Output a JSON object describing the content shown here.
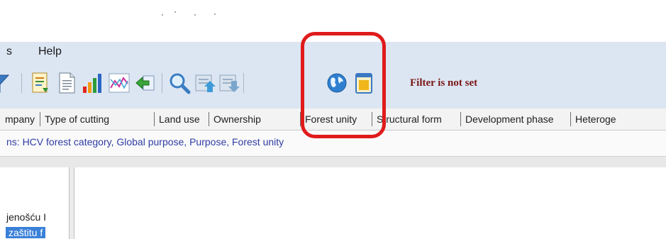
{
  "menu": {
    "items": [
      "s",
      "Help"
    ]
  },
  "toolbar": {
    "icons": [
      "filter-funnel-icon",
      "document-report-icon",
      "document-page-icon",
      "bar-chart-icon",
      "line-graph-icon",
      "back-arrow-icon",
      "magnifier-icon",
      "export-up-icon",
      "import-down-icon",
      "globe-icon",
      "calendar-icon"
    ],
    "filter_status": "Filter is not set"
  },
  "tabs": [
    "mpany",
    "Type of cutting",
    "Land use",
    "Ownership",
    "Forest unity",
    "Structural form",
    "Development phase",
    "Heteroge"
  ],
  "columns_line": "ns: HCV forest category, Global purpose, Purpose, Forest unity",
  "left_pane": {
    "rows": [
      "jenošću I",
      "zaštitu f"
    ]
  },
  "colors": {
    "appbar": "#dce6f2",
    "highlight": "#e01b1b",
    "filter_text": "#7a1616",
    "columns_text": "#2f3da3",
    "selection": "#3a80d8"
  }
}
